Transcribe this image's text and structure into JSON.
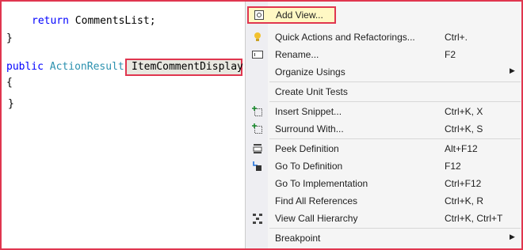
{
  "editor": {
    "line1_keyword": "return",
    "line1_rest": " CommentsList;",
    "line2": "}",
    "line3_keyword": "public",
    "line3_type": "ActionResult",
    "line3_method": "ItemCommentDisplay",
    "line4": "{",
    "line5": "}"
  },
  "menu": {
    "items": [
      {
        "label": "Add View...",
        "shortcut": "",
        "icon": "add-view-icon"
      },
      {
        "label": "Quick Actions and Refactorings...",
        "shortcut": "Ctrl+.",
        "icon": "lightbulb-icon"
      },
      {
        "label": "Rename...",
        "shortcut": "F2",
        "icon": "rename-icon"
      },
      {
        "label": "Organize Usings",
        "shortcut": "",
        "icon": "",
        "submenu": true
      },
      {
        "label": "Create Unit Tests",
        "shortcut": "",
        "icon": ""
      },
      {
        "label": "Insert Snippet...",
        "shortcut": "Ctrl+K, X",
        "icon": "insert-snippet-icon"
      },
      {
        "label": "Surround With...",
        "shortcut": "Ctrl+K, S",
        "icon": "surround-with-icon"
      },
      {
        "label": "Peek Definition",
        "shortcut": "Alt+F12",
        "icon": "peek-definition-icon"
      },
      {
        "label": "Go To Definition",
        "shortcut": "F12",
        "icon": "go-to-definition-icon"
      },
      {
        "label": "Go To Implementation",
        "shortcut": "Ctrl+F12",
        "icon": ""
      },
      {
        "label": "Find All References",
        "shortcut": "Ctrl+K, R",
        "icon": ""
      },
      {
        "label": "View Call Hierarchy",
        "shortcut": "Ctrl+K, Ctrl+T",
        "icon": "call-hierarchy-icon"
      },
      {
        "label": "Breakpoint",
        "shortcut": "",
        "icon": "",
        "submenu": true
      }
    ]
  },
  "colors": {
    "highlight_border": "#e0364f",
    "highlight_fill": "#fff8c4",
    "keyword": "#0000ff",
    "type": "#2b91af"
  }
}
